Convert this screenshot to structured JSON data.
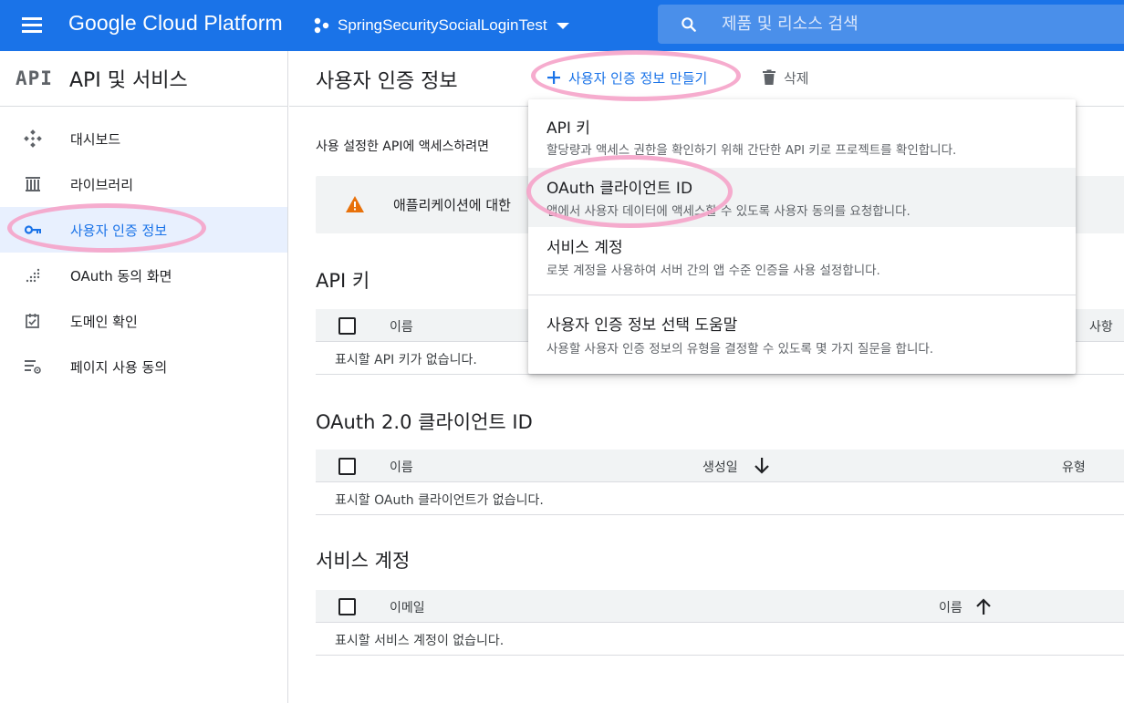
{
  "topbar": {
    "brand": "Google Cloud Platform",
    "project_name": "SpringSecuritySocialLoginTest",
    "search_placeholder": "제품 및 리소스 검색"
  },
  "sidebar": {
    "logo": "API",
    "title": "API 및 서비스",
    "items": [
      {
        "label": "대시보드",
        "icon": "dashboard-icon"
      },
      {
        "label": "라이브러리",
        "icon": "library-icon"
      },
      {
        "label": "사용자 인증 정보",
        "icon": "key-icon",
        "active": true
      },
      {
        "label": "OAuth 동의 화면",
        "icon": "consent-icon"
      },
      {
        "label": "도메인 확인",
        "icon": "checkbox-icon"
      },
      {
        "label": "페이지 사용 동의",
        "icon": "settings-list-icon"
      }
    ]
  },
  "main": {
    "page_title": "사용자 인증 정보",
    "create_label": "사용자 인증 정보 만들기",
    "delete_label": "삭제",
    "intro_text": "사용 설정한 API에 액세스하려면",
    "warning_text": "애플리케이션에 대한",
    "api_keys": {
      "title": "API 키",
      "columns": [
        "이름",
        "사항"
      ],
      "empty": "표시할 API 키가 없습니다."
    },
    "oauth": {
      "title": "OAuth 2.0 클라이언트 ID",
      "columns": [
        "이름",
        "생성일",
        "유형"
      ],
      "empty": "표시할 OAuth 클라이언트가 없습니다."
    },
    "service_accounts": {
      "title": "서비스 계정",
      "columns": [
        "이메일",
        "이름"
      ],
      "empty": "표시할 서비스 계정이 없습니다."
    }
  },
  "dropdown": {
    "items": [
      {
        "title": "API 키",
        "desc": "할당량과 액세스 권한을 확인하기 위해 간단한 API 키로 프로젝트를 확인합니다."
      },
      {
        "title": "OAuth 클라이언트 ID",
        "desc": "앱에서 사용자 데이터에 액세스할 수 있도록 사용자 동의를 요청합니다.",
        "hovered": true
      },
      {
        "title": "서비스 계정",
        "desc": "로봇 계정을 사용하여 서버 간의 앱 수준 인증을 사용 설정합니다."
      },
      {
        "title": "사용자 인증 정보 선택 도움말",
        "desc": "사용할 사용자 인증 정보의 유형을 결정할 수 있도록 몇 가지 질문을 합니다."
      }
    ]
  },
  "colors": {
    "brand_blue": "#1a73e8",
    "highlight_pink": "#f5a3c9",
    "warning_orange": "#e8710a"
  }
}
